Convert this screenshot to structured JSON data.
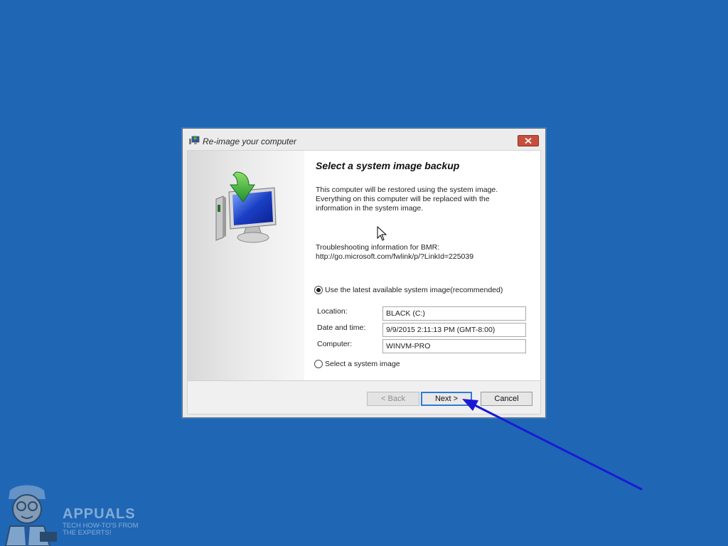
{
  "window": {
    "title": "Re-image your computer",
    "close_icon": "close-icon"
  },
  "content": {
    "heading": "Select a system image backup",
    "description_lines": [
      "This computer will be restored using the system image.",
      "Everything on this computer will be replaced with the",
      "information in the system image."
    ],
    "troubleshooting_lines": [
      "Troubleshooting information for BMR:",
      "http://go.microsoft.com/fwlink/p/?LinkId=225039"
    ]
  },
  "options": {
    "latest": {
      "label": "Use the latest available system image(recommended)",
      "selected": true
    },
    "select": {
      "label": "Select a system image",
      "selected": false
    }
  },
  "details": {
    "location_label": "Location:",
    "location_value": "BLACK (C:)",
    "datetime_label": "Date and time:",
    "datetime_value": "9/9/2015 2:11:13 PM (GMT-8:00)",
    "computer_label": "Computer:",
    "computer_value": "WINVM-PRO"
  },
  "buttons": {
    "back": "< Back",
    "next": "Next >",
    "cancel": "Cancel"
  },
  "watermark": {
    "brand": "APPUALS",
    "tagline_lines": [
      "TECH HOW-TO'S FROM",
      "THE EXPERTS!"
    ]
  },
  "colors": {
    "desktop": "#1f67b5",
    "close_button": "#c7503d",
    "focus_border": "#2f7ad5",
    "annotation_arrow": "#1a1ad6"
  }
}
